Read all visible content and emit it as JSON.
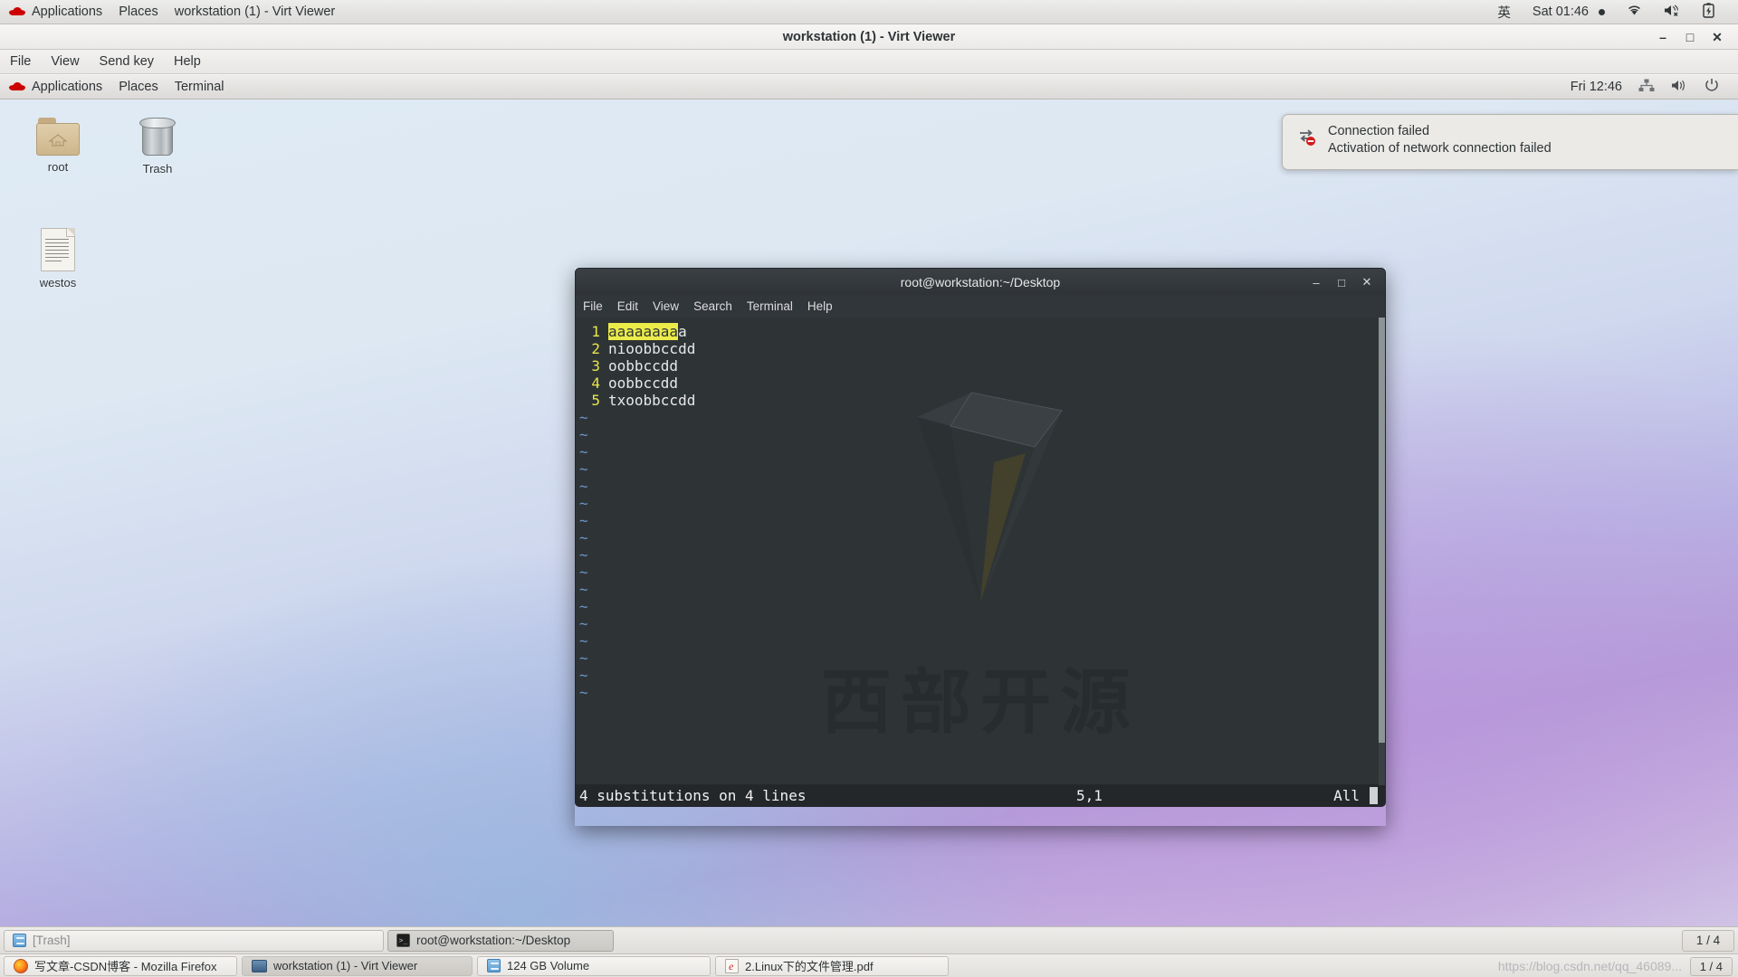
{
  "host_panel": {
    "logo": "redhat-logo",
    "items": [
      {
        "label": "Applications"
      },
      {
        "label": "Places"
      },
      {
        "label": "workstation (1) - Virt Viewer"
      }
    ],
    "right": {
      "input_method": "英",
      "clock": "Sat 01:46",
      "icons": [
        "wifi-icon",
        "volume-muted-icon",
        "battery-charging-icon"
      ]
    }
  },
  "virt_viewer": {
    "title": "workstation (1) - Virt Viewer",
    "window_buttons": {
      "minimize": "–",
      "maximize": "□",
      "close": "✕"
    },
    "menu": [
      {
        "label": "File"
      },
      {
        "label": "View"
      },
      {
        "label": "Send key"
      },
      {
        "label": "Help"
      }
    ]
  },
  "guest_panel": {
    "logo": "redhat-logo",
    "items": [
      {
        "label": "Applications"
      },
      {
        "label": "Places"
      },
      {
        "label": "Terminal"
      }
    ],
    "right": {
      "clock": "Fri 12:46",
      "icons": [
        "network-icon",
        "volume-icon",
        "power-icon"
      ]
    }
  },
  "desktop": {
    "icons": [
      {
        "name": "root",
        "label": "root",
        "type": "home-folder-icon"
      },
      {
        "name": "trash",
        "label": "Trash",
        "type": "trash-icon"
      },
      {
        "name": "westos",
        "label": "westos",
        "type": "text-document-icon"
      }
    ],
    "watermark": "https://blog.csdn.net/qq_46089..."
  },
  "notification": {
    "icon": "network-error-icon",
    "title": "Connection failed",
    "body": "Activation of network connection failed"
  },
  "terminal": {
    "title": "root@workstation:~/Desktop",
    "window_buttons": {
      "minimize": "–",
      "maximize": "□",
      "close": "✕"
    },
    "menu": [
      {
        "label": "File"
      },
      {
        "label": "Edit"
      },
      {
        "label": "View"
      },
      {
        "label": "Search"
      },
      {
        "label": "Terminal"
      },
      {
        "label": "Help"
      }
    ],
    "wallpaper_text": "西部开源",
    "lines": [
      {
        "num": "1",
        "highlight": "aaaaaaaa",
        "rest": "a"
      },
      {
        "num": "2",
        "highlight": "",
        "rest": "nioobbccdd"
      },
      {
        "num": "3",
        "highlight": "",
        "rest": "oobbccdd"
      },
      {
        "num": "4",
        "highlight": "",
        "rest": "oobbccdd"
      },
      {
        "num": "5",
        "highlight": "",
        "rest": "txoobbccdd"
      }
    ],
    "empty_marker": "~",
    "empty_count": 17,
    "status": {
      "message": "4 substitutions on 4 lines",
      "position": "5,1",
      "scroll": "All"
    }
  },
  "guest_taskbar": {
    "buttons": [
      {
        "label": "[Trash]",
        "icon": "drive-icon",
        "active": false,
        "dim": true
      },
      {
        "label": "root@workstation:~/Desktop",
        "icon": "terminal-icon",
        "active": true,
        "dim": false
      }
    ],
    "pager": "1 / 4"
  },
  "host_taskbar": {
    "buttons": [
      {
        "label": "写文章-CSDN博客 - Mozilla Firefox",
        "icon": "firefox-icon",
        "active": false
      },
      {
        "label": "workstation (1) - Virt Viewer",
        "icon": "monitor-icon",
        "active": true
      },
      {
        "label": "124 GB Volume",
        "icon": "drive-icon",
        "active": false
      },
      {
        "label": "2.Linux下的文件管理.pdf",
        "icon": "pdf-icon",
        "active": false
      }
    ],
    "watermark": "https://blog.csdn.net/qq_46089...",
    "pager": "1 / 4"
  },
  "colors": {
    "panel_bg": "#e6e4e1",
    "terminal_bg": "#2e3436",
    "terminal_status_bg": "#23272a",
    "line_number": "#e7e74a",
    "highlight": "#ebeb4a",
    "accent_red": "#cc0000"
  }
}
